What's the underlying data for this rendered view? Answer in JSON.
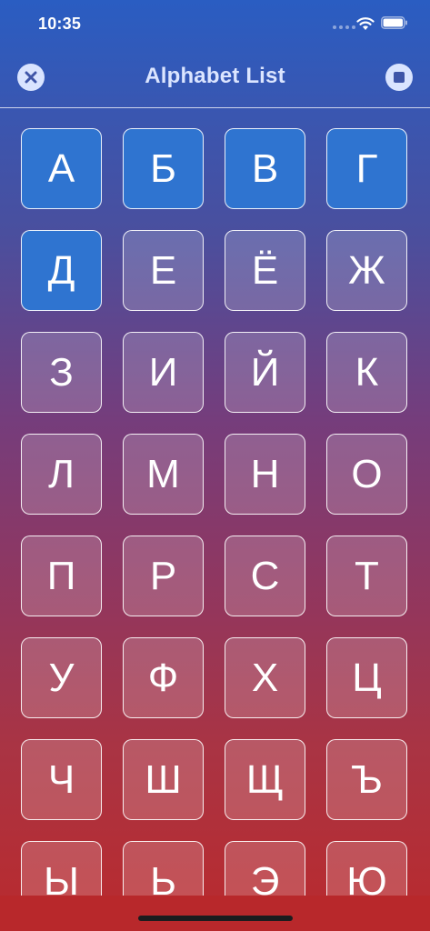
{
  "status_bar": {
    "time": "10:35",
    "icons": [
      "signal-icon",
      "wifi-icon",
      "battery-icon"
    ]
  },
  "nav": {
    "title": "Alphabet List",
    "left_icon": "close-icon",
    "right_icon": "stop-icon"
  },
  "colors": {
    "active_tile": "#2f74d0",
    "nav_title": "#dbe5ff",
    "gradient_top": "#2a5dc2",
    "gradient_bottom": "#ba2a2d"
  },
  "letters": [
    {
      "char": "А",
      "active": true
    },
    {
      "char": "Б",
      "active": true
    },
    {
      "char": "В",
      "active": true
    },
    {
      "char": "Г",
      "active": true
    },
    {
      "char": "Д",
      "active": true
    },
    {
      "char": "Е",
      "active": false
    },
    {
      "char": "Ё",
      "active": false
    },
    {
      "char": "Ж",
      "active": false
    },
    {
      "char": "З",
      "active": false
    },
    {
      "char": "И",
      "active": false
    },
    {
      "char": "Й",
      "active": false
    },
    {
      "char": "К",
      "active": false
    },
    {
      "char": "Л",
      "active": false
    },
    {
      "char": "М",
      "active": false
    },
    {
      "char": "Н",
      "active": false
    },
    {
      "char": "О",
      "active": false
    },
    {
      "char": "П",
      "active": false
    },
    {
      "char": "Р",
      "active": false
    },
    {
      "char": "С",
      "active": false
    },
    {
      "char": "Т",
      "active": false
    },
    {
      "char": "У",
      "active": false
    },
    {
      "char": "Ф",
      "active": false
    },
    {
      "char": "Х",
      "active": false
    },
    {
      "char": "Ц",
      "active": false
    },
    {
      "char": "Ч",
      "active": false
    },
    {
      "char": "Ш",
      "active": false
    },
    {
      "char": "Щ",
      "active": false
    },
    {
      "char": "Ъ",
      "active": false
    },
    {
      "char": "Ы",
      "active": false
    },
    {
      "char": "Ь",
      "active": false
    },
    {
      "char": "Э",
      "active": false
    },
    {
      "char": "Ю",
      "active": false
    }
  ]
}
